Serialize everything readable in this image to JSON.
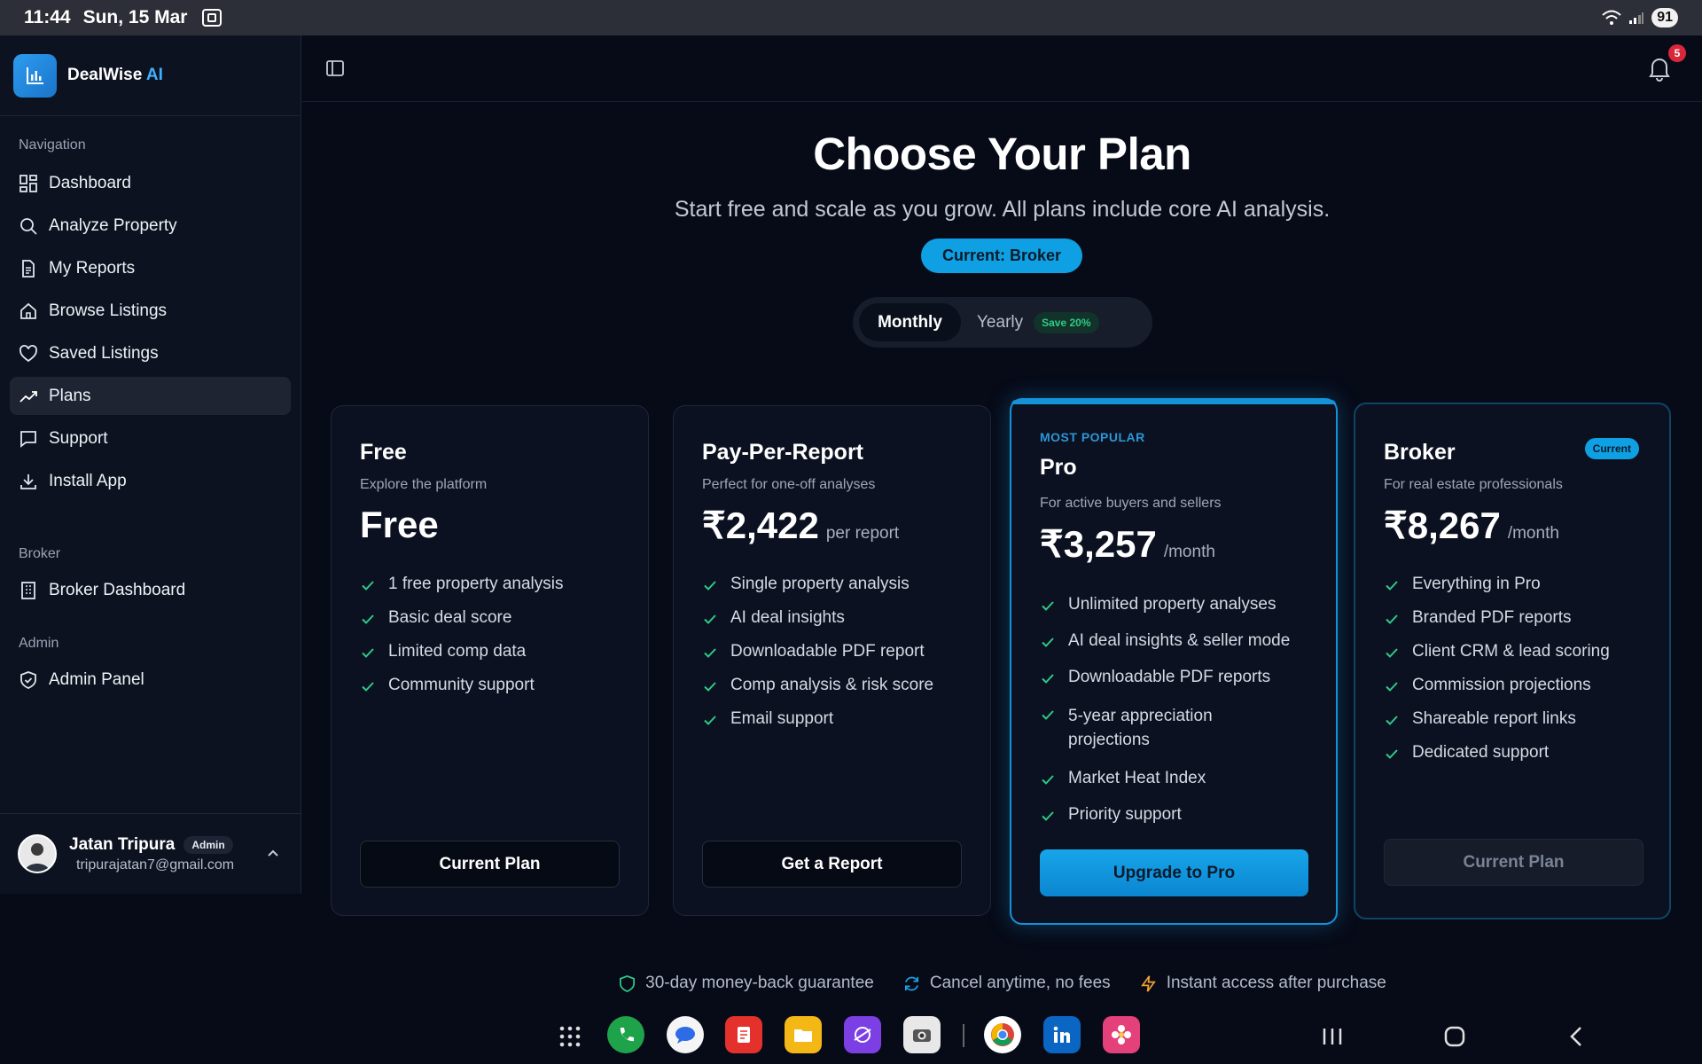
{
  "status_bar": {
    "time": "11:44",
    "date": "Sun, 15 Mar",
    "battery": "91"
  },
  "brand": {
    "name": "DealWise",
    "suffix": "AI"
  },
  "sidebar": {
    "sections": [
      {
        "title": "Navigation"
      },
      {
        "title": "Broker"
      },
      {
        "title": "Admin"
      }
    ],
    "nav": [
      {
        "label": "Dashboard",
        "icon": "dashboard-icon"
      },
      {
        "label": "Analyze Property",
        "icon": "search-icon"
      },
      {
        "label": "My Reports",
        "icon": "document-icon"
      },
      {
        "label": "Browse Listings",
        "icon": "home-icon"
      },
      {
        "label": "Saved Listings",
        "icon": "heart-icon"
      },
      {
        "label": "Plans",
        "icon": "trending-up-icon",
        "active": true
      },
      {
        "label": "Support",
        "icon": "message-icon"
      },
      {
        "label": "Install App",
        "icon": "download-icon"
      }
    ],
    "broker_nav": [
      {
        "label": "Broker Dashboard",
        "icon": "building-icon"
      }
    ],
    "admin_nav": [
      {
        "label": "Admin Panel",
        "icon": "shield-icon"
      }
    ]
  },
  "user": {
    "name": "Jatan Tripura",
    "role": "Admin",
    "email": "tripurajatan7@gmail.com"
  },
  "notifications": {
    "count": "5"
  },
  "header": {
    "title": "Choose Your Plan",
    "subtitle": "Start free and scale as you grow. All plans include core AI analysis.",
    "current_plan": "Current: Broker"
  },
  "billing_toggle": {
    "monthly": "Monthly",
    "yearly": "Yearly",
    "save": "Save 20%",
    "selected": "Monthly"
  },
  "plans": [
    {
      "name": "Free",
      "description": "Explore the platform",
      "price": "Free",
      "period": "",
      "features": [
        "1 free property analysis",
        "Basic deal score",
        "Limited comp data",
        "Community support"
      ],
      "button": "Current Plan"
    },
    {
      "name": "Pay-Per-Report",
      "description": "Perfect for one-off analyses",
      "price": "₹2,422",
      "period": "per report",
      "features": [
        "Single property analysis",
        "AI deal insights",
        "Downloadable PDF report",
        "Comp analysis & risk score",
        "Email support"
      ],
      "button": "Get a Report"
    },
    {
      "badge": "MOST POPULAR",
      "name": "Pro",
      "description": "For active buyers and sellers",
      "price": "₹3,257",
      "period": "/month",
      "features": [
        "Unlimited property analyses",
        "AI deal insights & seller mode",
        "Downloadable PDF reports",
        "5-year appreciation projections",
        "Market Heat Index",
        "Priority support"
      ],
      "button": "Upgrade to Pro"
    },
    {
      "name": "Broker",
      "badge": "Current",
      "description": "For real estate professionals",
      "price": "₹8,267",
      "period": "/month",
      "features": [
        "Everything in Pro",
        "Branded PDF reports",
        "Client CRM & lead scoring",
        "Commission projections",
        "Shareable report links",
        "Dedicated support"
      ],
      "button": "Current Plan"
    }
  ],
  "guarantees": [
    {
      "label": "30-day money-back guarantee",
      "icon": "shield-icon"
    },
    {
      "label": "Cancel anytime, no fees",
      "icon": "refresh-icon"
    },
    {
      "label": "Instant access after purchase",
      "icon": "lightning-icon"
    }
  ],
  "colors": {
    "accent": "#0fa0e3",
    "check": "#2ecb88",
    "background": "#070b18"
  }
}
